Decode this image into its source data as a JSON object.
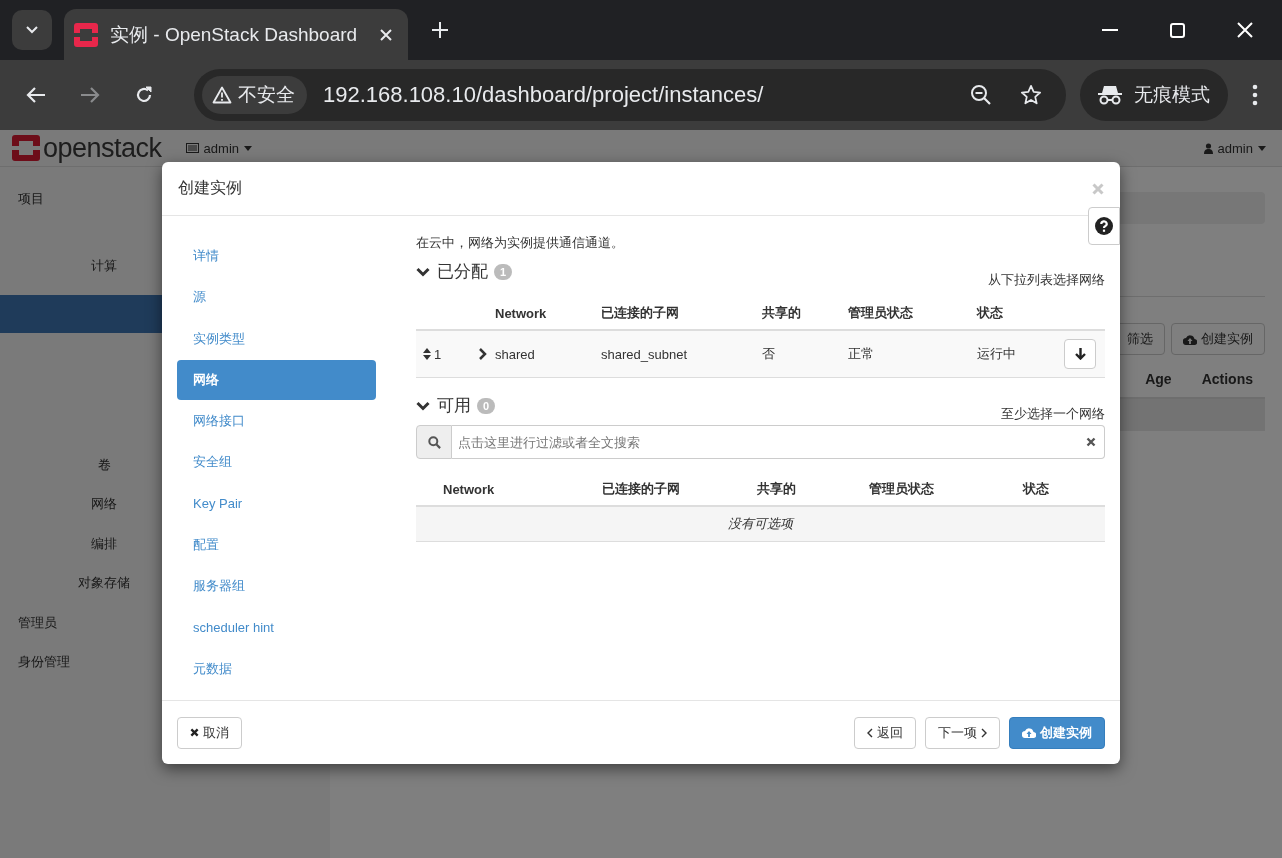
{
  "browser": {
    "tab_title": "实例 - OpenStack Dashboard",
    "security_label": "不安全",
    "url": "192.168.108.10/dashboard/project/instances/",
    "incognito_label": "无痕模式"
  },
  "page": {
    "brand": "openstack",
    "project_menu": "admin",
    "user_menu": "admin",
    "sidebar": [
      {
        "label": "项目",
        "kind": "dashboard"
      },
      {
        "label": "计算",
        "kind": "group"
      },
      {
        "label": "卷",
        "kind": "panel"
      },
      {
        "label": "网络",
        "kind": "panel"
      },
      {
        "label": "编排",
        "kind": "panel"
      },
      {
        "label": "对象存储",
        "kind": "panel"
      },
      {
        "label": "管理员",
        "kind": "dashboard"
      },
      {
        "label": "身份管理",
        "kind": "dashboard"
      }
    ],
    "filter_button": "筛选",
    "create_button": "创建实例",
    "columns": [
      "Age",
      "Actions"
    ]
  },
  "modal": {
    "title": "创建实例",
    "steps": [
      {
        "label": "详情",
        "selected": false
      },
      {
        "label": "源",
        "selected": false
      },
      {
        "label": "实例类型",
        "selected": false
      },
      {
        "label": "网络",
        "selected": true
      },
      {
        "label": "网络接口",
        "selected": false
      },
      {
        "label": "安全组",
        "selected": false
      },
      {
        "label": "Key Pair",
        "selected": false
      },
      {
        "label": "配置",
        "selected": false
      },
      {
        "label": "服务器组",
        "selected": false
      },
      {
        "label": "scheduler hint",
        "selected": false
      },
      {
        "label": "元数据",
        "selected": false
      }
    ],
    "description": "在云中，网络为实例提供通信通道。",
    "allocated": {
      "title": "已分配",
      "count": "1",
      "expanded": true,
      "hint": "从下拉列表选择网络",
      "columns": [
        "Network",
        "已连接的子网",
        "共享的",
        "管理员状态",
        "状态"
      ],
      "rows": [
        {
          "order": "1",
          "network": "shared",
          "subnet": "shared_subnet",
          "shared": "否",
          "admin_state": "正常",
          "status": "运行中"
        }
      ]
    },
    "available": {
      "title": "可用",
      "count": "0",
      "expanded": true,
      "hint": "至少选择一个网络",
      "search_placeholder": "点击这里进行过滤或者全文搜索",
      "columns": [
        "Network",
        "已连接的子网",
        "共享的",
        "管理员状态",
        "状态"
      ],
      "empty_text": "没有可选项"
    },
    "footer": {
      "cancel": "取消",
      "back": "返回",
      "next": "下一项",
      "create": "创建实例"
    }
  }
}
